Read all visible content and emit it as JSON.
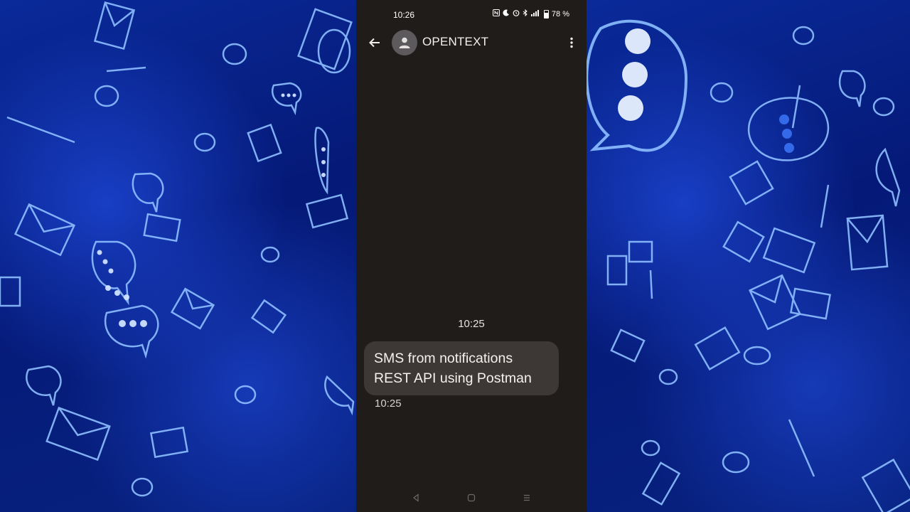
{
  "status_bar": {
    "time": "10:26",
    "battery": "78 %",
    "icons": [
      "nfc-icon",
      "moon-icon",
      "alarm-icon",
      "bluetooth-icon",
      "signal-icon",
      "battery-icon"
    ]
  },
  "conversation": {
    "contact_name": "OPENTEXT",
    "back_icon": "arrow-left-icon",
    "avatar_icon": "person-icon",
    "menu_icon": "more-vert-icon"
  },
  "messages": {
    "date_header": "10:25",
    "items": [
      {
        "text": "SMS from notifications REST API using Postman",
        "time": "10:25"
      }
    ]
  },
  "nav_bar": {
    "icons": [
      "nav-back-icon",
      "nav-home-icon",
      "nav-recents-icon"
    ]
  },
  "colors": {
    "background_blue": "#061a6b",
    "phone_bg": "#201c1a",
    "bubble_bg": "#3d3835",
    "glow": "#7fb0ff"
  }
}
